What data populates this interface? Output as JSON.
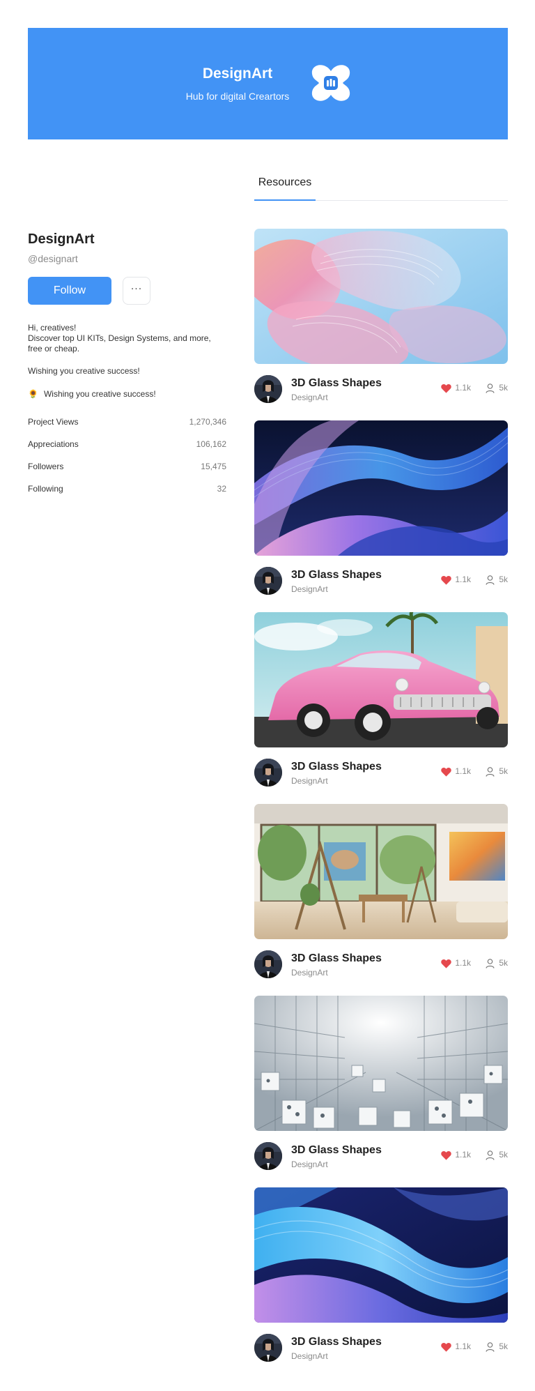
{
  "banner": {
    "title": "DesignArt",
    "subtitle": "Hub for digital Creartors",
    "logo_icon": "designart-logo-icon",
    "background": "#4293f5"
  },
  "tabs": [
    {
      "label": "Resources",
      "active": true
    }
  ],
  "profile": {
    "name": "DesignArt",
    "handle": "@designart",
    "follow_label": "Follow",
    "more_label": "···",
    "bio_line1": "Hi, creatives!",
    "bio_line2": "Discover top UI KITs, Design Systems, and more, free or cheap.",
    "wish1": "Wishing you creative success!",
    "wish2_emoji": "🌻",
    "wish2": "Wishing you creative success!"
  },
  "stats": [
    {
      "label": "Project Views",
      "value": "1,270,346"
    },
    {
      "label": "Appreciations",
      "value": "106,162"
    },
    {
      "label": "Followers",
      "value": "15,475"
    },
    {
      "label": "Following",
      "value": "32"
    }
  ],
  "cards": [
    {
      "title": "3D Glass Shapes",
      "author": "DesignArt",
      "likes": "1.1k",
      "views": "5k",
      "image": "pink-glass-shapes"
    },
    {
      "title": "3D Glass Shapes",
      "author": "DesignArt",
      "likes": "1.1k",
      "views": "5k",
      "image": "blue-purple-waves"
    },
    {
      "title": "3D Glass Shapes",
      "author": "DesignArt",
      "likes": "1.1k",
      "views": "5k",
      "image": "pink-vintage-car"
    },
    {
      "title": "3D Glass Shapes",
      "author": "DesignArt",
      "likes": "1.1k",
      "views": "5k",
      "image": "art-studio-interior"
    },
    {
      "title": "3D Glass Shapes",
      "author": "DesignArt",
      "likes": "1.1k",
      "views": "5k",
      "image": "white-cubes-structure"
    },
    {
      "title": "3D Glass Shapes",
      "author": "DesignArt",
      "likes": "1.1k",
      "views": "5k",
      "image": "blue-glass-waves"
    }
  ],
  "colors": {
    "accent": "#4293f5",
    "heart": "#e5484d",
    "muted": "#8a8a8a"
  },
  "icons": {
    "like": "heart-icon",
    "views": "user-icon"
  }
}
